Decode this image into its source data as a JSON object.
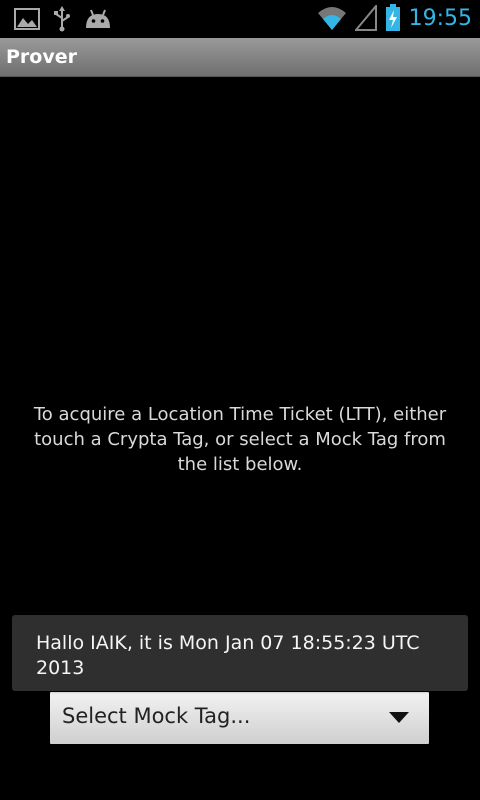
{
  "status_bar": {
    "time": "19:55",
    "left_icons": [
      "image-icon",
      "usb-icon",
      "android-debug-icon"
    ],
    "right_icons": [
      "wifi-icon",
      "signal-icon",
      "battery-charging-icon"
    ],
    "accent_color": "#33b5e5"
  },
  "app": {
    "title": "Prover"
  },
  "main": {
    "instructions": "To acquire a Location Time Ticket (LTT), either touch a Crypta Tag, or select a Mock Tag from the list below."
  },
  "toast": {
    "message": "Hallo IAIK, it is Mon Jan 07 18:55:23 UTC 2013"
  },
  "spinner": {
    "selected": "Select Mock Tag..."
  }
}
